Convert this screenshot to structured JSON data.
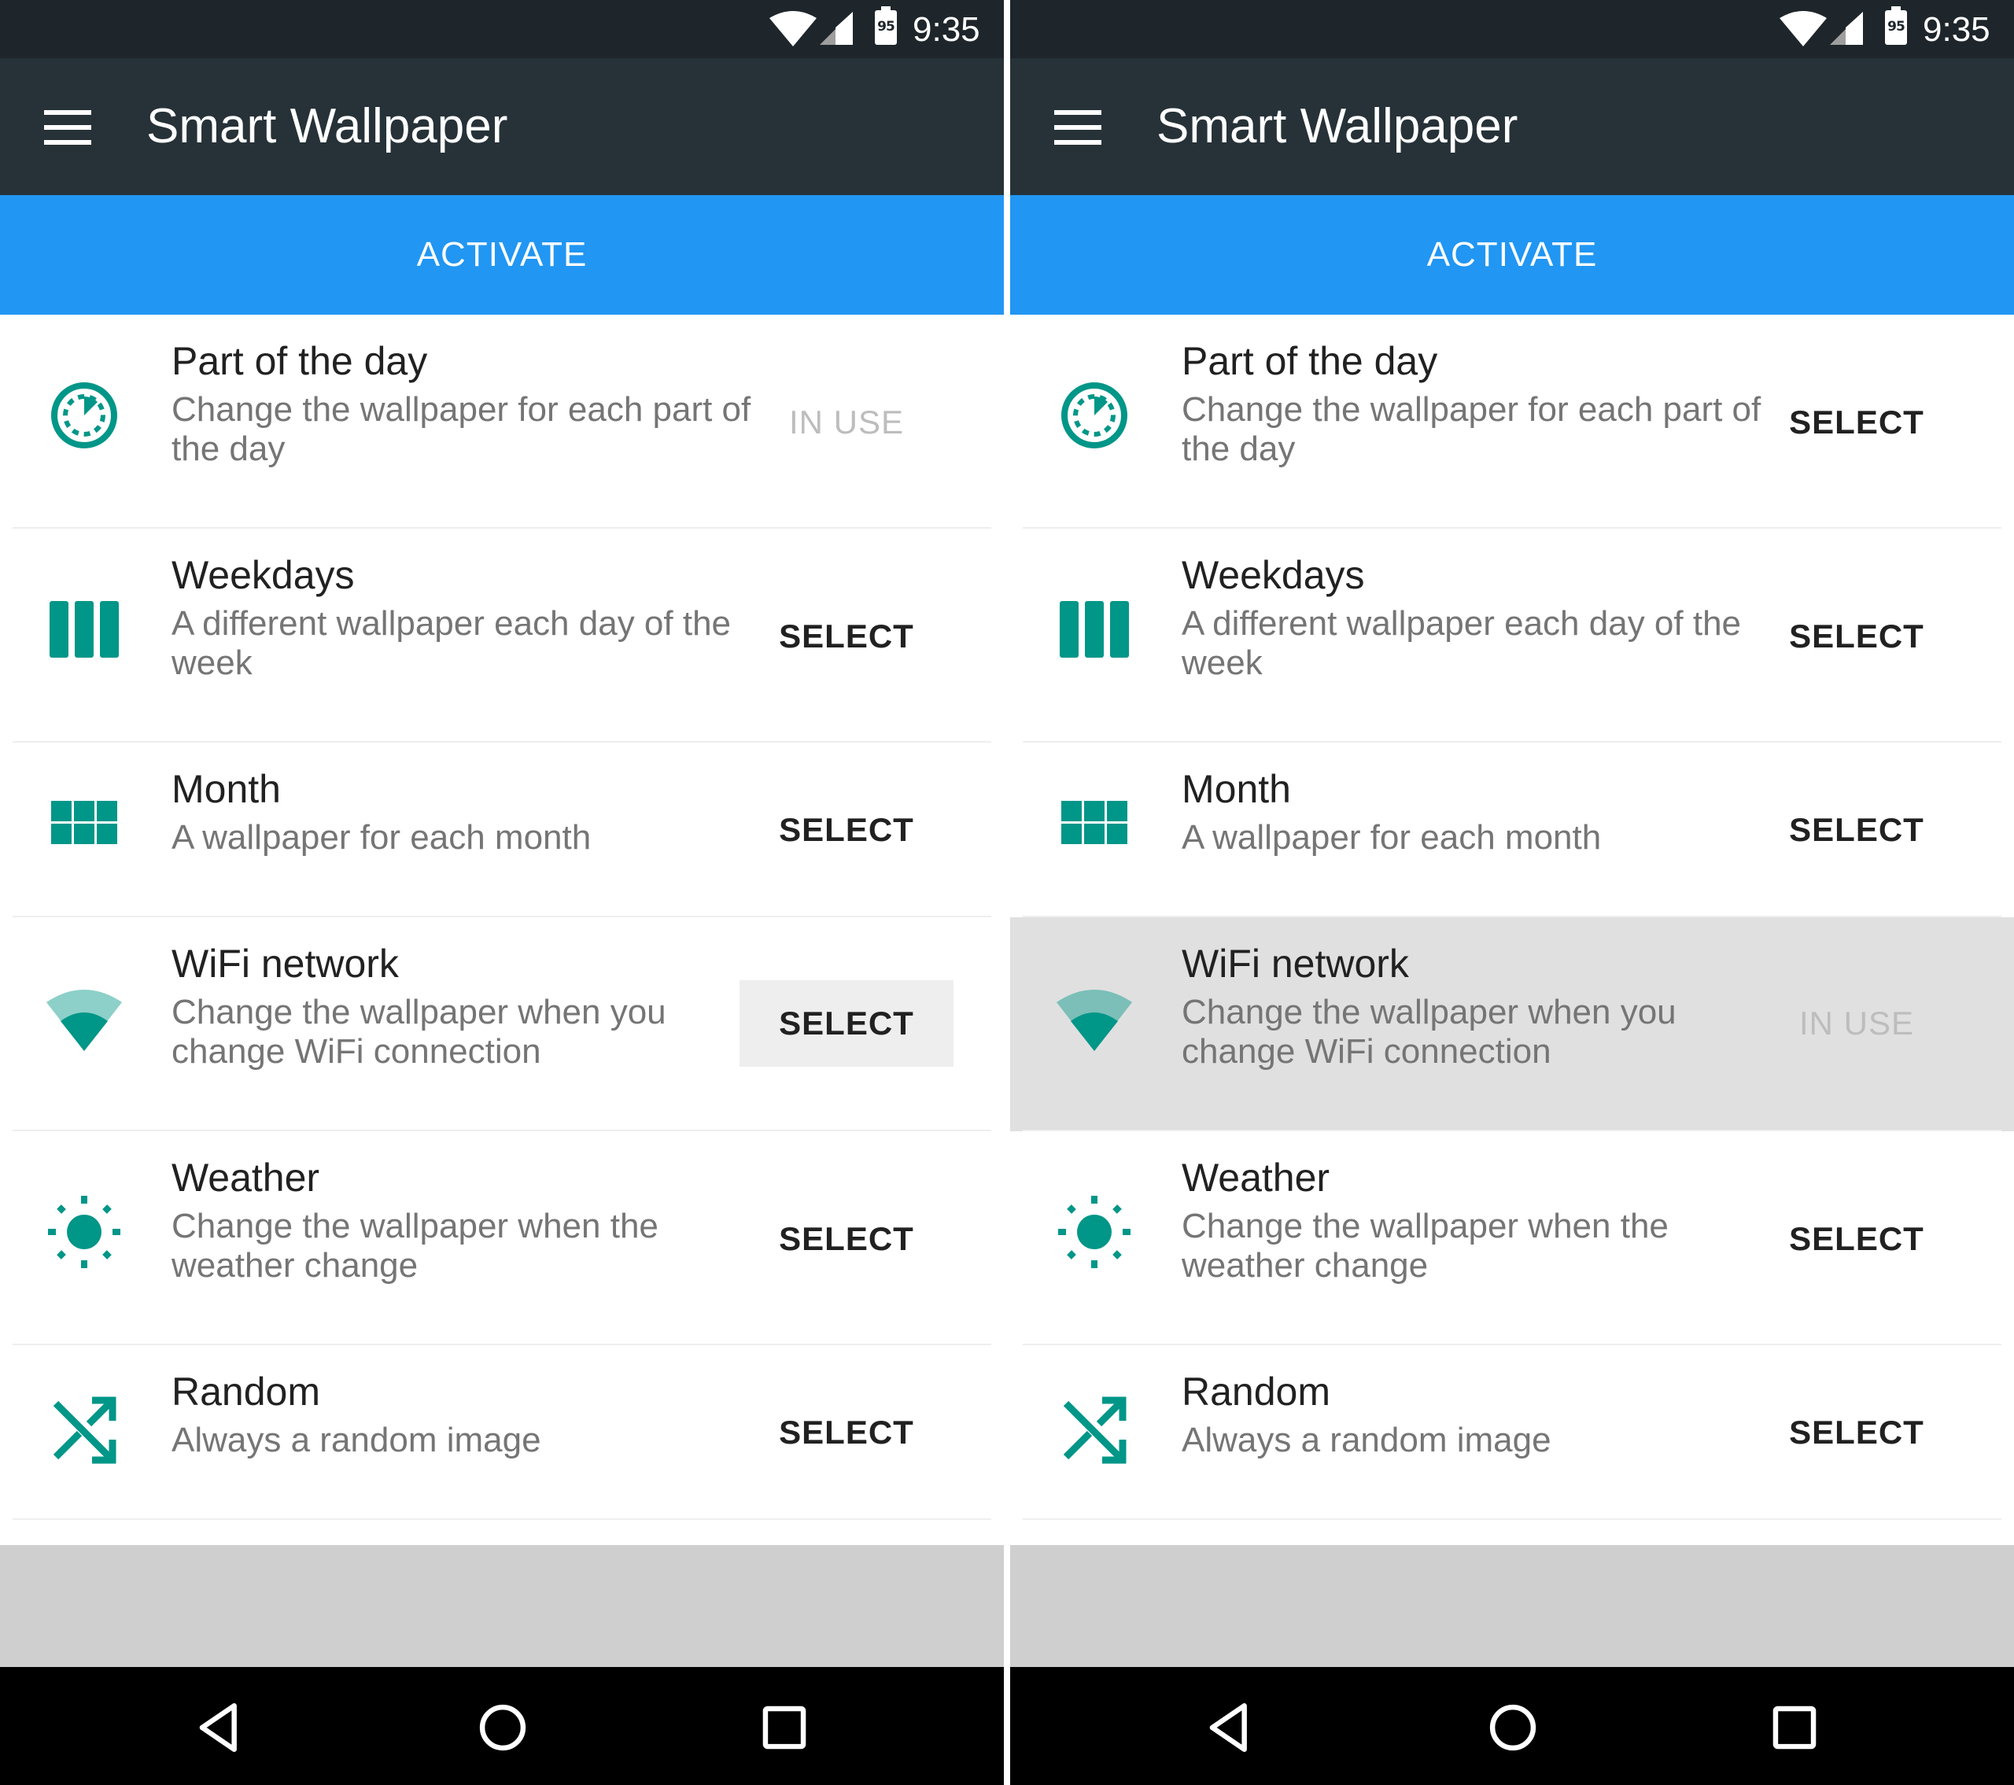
{
  "colors": {
    "status_bar": "#1e262b",
    "app_bar": "#263238",
    "accent": "#2196f3",
    "icon_teal": "#009688",
    "highlight_row": "#e0e0e0"
  },
  "screens": [
    {
      "status": {
        "time": "9:35",
        "battery": "95"
      },
      "app_bar": {
        "title": "Smart Wallpaper",
        "menu_icon": "hamburger-menu-icon"
      },
      "activate_label": "ACTIVATE",
      "modes": [
        {
          "title": "Part of the day",
          "description": "Change the wallpaper for each part of the day",
          "action": "IN USE",
          "icon": "timelapse-icon"
        },
        {
          "title": "Weekdays",
          "description": "A different wallpaper each day of the week",
          "action": "SELECT",
          "icon": "week-view-icon"
        },
        {
          "title": "Month",
          "description": "A wallpaper for each month",
          "action": "SELECT",
          "icon": "grid-view-icon"
        },
        {
          "title": "WiFi network",
          "description": "Change the wallpaper when you change WiFi connection",
          "action": "SELECT",
          "icon": "wifi-icon"
        },
        {
          "title": "Weather",
          "description": "Change the wallpaper when the weather change",
          "action": "SELECT",
          "icon": "sun-icon"
        },
        {
          "title": "Random",
          "description": "Always a random image",
          "action": "SELECT",
          "icon": "shuffle-icon"
        }
      ],
      "nav": [
        "back-icon",
        "home-icon",
        "recents-icon"
      ]
    },
    {
      "status": {
        "time": "9:35",
        "battery": "95"
      },
      "app_bar": {
        "title": "Smart Wallpaper",
        "menu_icon": "hamburger-menu-icon"
      },
      "activate_label": "ACTIVATE",
      "modes": [
        {
          "title": "Part of the day",
          "description": "Change the wallpaper for each part of the day",
          "action": "SELECT",
          "icon": "timelapse-icon"
        },
        {
          "title": "Weekdays",
          "description": "A different wallpaper each day of the week",
          "action": "SELECT",
          "icon": "week-view-icon"
        },
        {
          "title": "Month",
          "description": "A wallpaper for each month",
          "action": "SELECT",
          "icon": "grid-view-icon"
        },
        {
          "title": "WiFi network",
          "description": "Change the wallpaper when you change WiFi connection",
          "action": "IN USE",
          "icon": "wifi-icon"
        },
        {
          "title": "Weather",
          "description": "Change the wallpaper when the weather change",
          "action": "SELECT",
          "icon": "sun-icon"
        },
        {
          "title": "Random",
          "description": "Always a random image",
          "action": "SELECT",
          "icon": "shuffle-icon"
        }
      ],
      "nav": [
        "back-icon",
        "home-icon",
        "recents-icon"
      ]
    }
  ]
}
